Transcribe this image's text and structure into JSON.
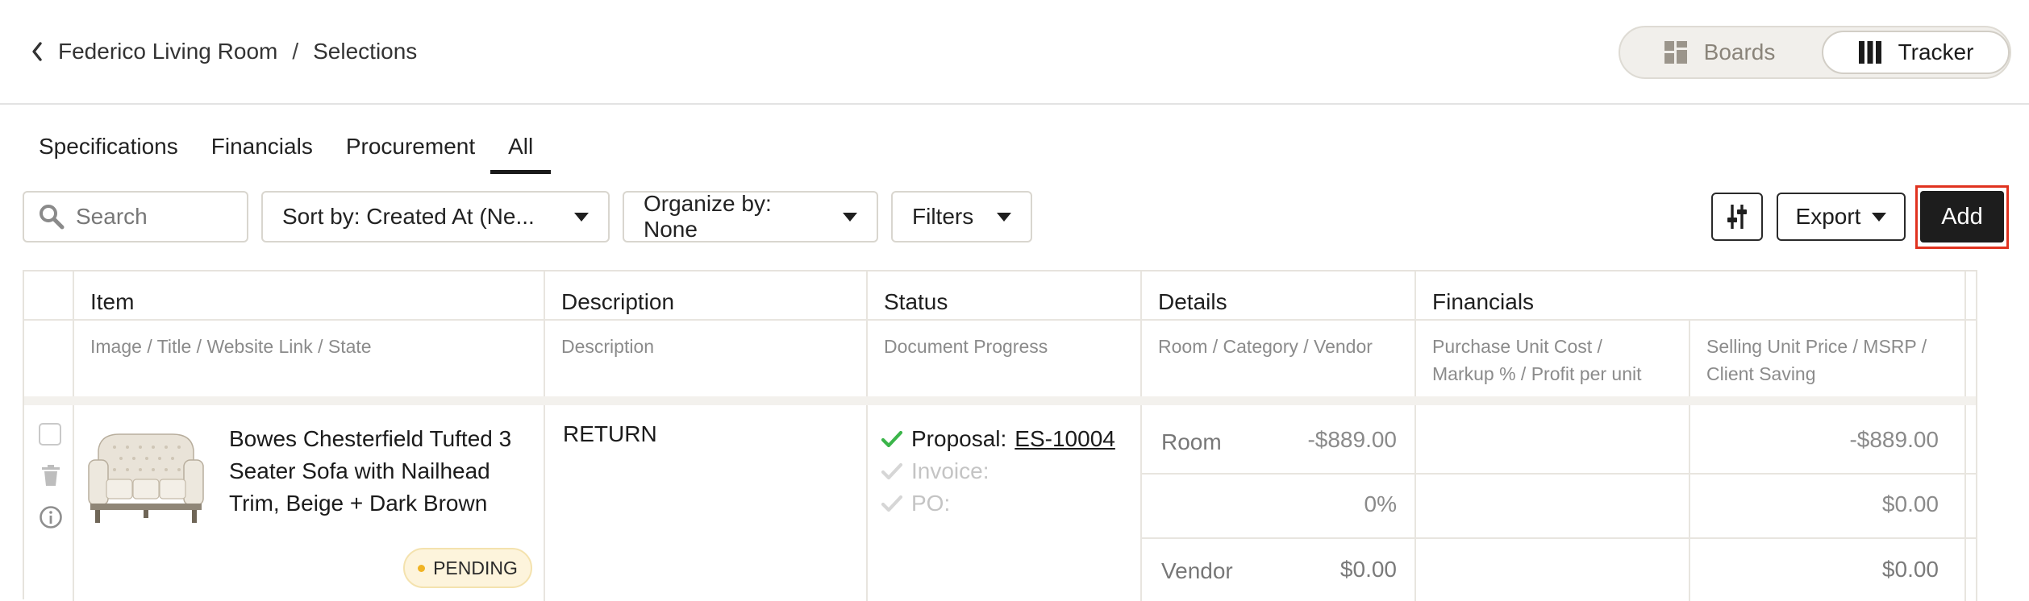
{
  "breadcrumb": {
    "project": "Federico Living Room",
    "separator": "/",
    "page": "Selections"
  },
  "view_toggle": {
    "boards_label": "Boards",
    "tracker_label": "Tracker",
    "active": "Tracker"
  },
  "tabs": [
    {
      "label": "Specifications"
    },
    {
      "label": "Financials"
    },
    {
      "label": "Procurement"
    },
    {
      "label": "All",
      "active": true
    }
  ],
  "toolbar": {
    "search_placeholder": "Search",
    "sort_label": "Sort by: Created At (Ne...",
    "organize_label": "Organize by: None",
    "filters_label": "Filters",
    "export_label": "Export",
    "add_label": "Add"
  },
  "table": {
    "columns": [
      {
        "title": "Item",
        "sub": "Image / Title / Website Link / State"
      },
      {
        "title": "Description",
        "sub": "Description"
      },
      {
        "title": "Status",
        "sub": "Document Progress"
      },
      {
        "title": "Details",
        "sub": "Room / Category / Vendor"
      },
      {
        "title": "Financials",
        "sub": "Purchase Unit Cost /",
        "sub2": "Markup % / Profit per unit"
      },
      {
        "title": "",
        "sub": "Selling Unit Price / MSRP /",
        "sub2": "Client Saving"
      }
    ],
    "row": {
      "title_line1": "Bowes Chesterfield Tufted 3",
      "title_line2": "Seater Sofa with Nailhead",
      "title_line3": "Trim, Beige + Dark Brown",
      "state": "PENDING",
      "description": "RETURN",
      "docs": {
        "proposal_label": "Proposal:",
        "proposal_link": "ES-10004",
        "invoice_label": "Invoice:",
        "po_label": "PO:"
      },
      "details": {
        "room": "Room",
        "category": "",
        "vendor": "Vendor"
      },
      "purchase": {
        "unit_cost": "-$889.00",
        "markup": "0%",
        "profit": "$0.00"
      },
      "selling": {
        "unit_price": "-$889.00",
        "msrp": "$0.00",
        "client_saving": "$0.00"
      }
    }
  },
  "colors": {
    "accent_highlight": "#e0321f",
    "check_green": "#3bb54a",
    "pending_dot": "#f0b323"
  }
}
